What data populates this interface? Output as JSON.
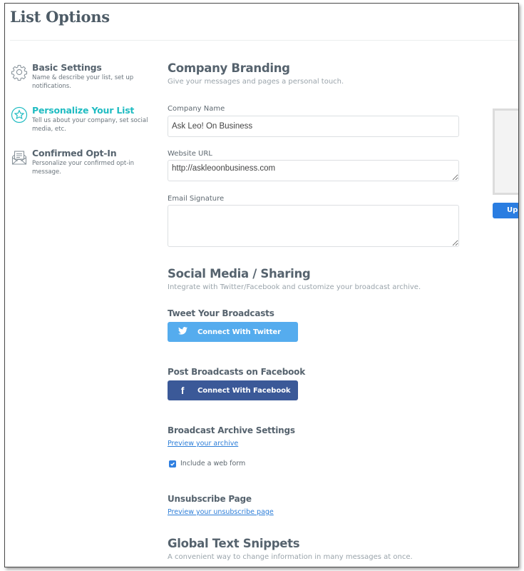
{
  "page": {
    "title": "List Options"
  },
  "sidebar": {
    "items": [
      {
        "label": "Basic Settings",
        "description": "Name & describe your list, set up notifications.",
        "icon": "gear-icon",
        "active": false
      },
      {
        "label": "Personalize Your List",
        "description": "Tell us about your company, set social media, etc.",
        "icon": "star-icon",
        "active": true
      },
      {
        "label": "Confirmed Opt-In",
        "description": "Personalize your confirmed opt-in message.",
        "icon": "envelope-icon",
        "active": false
      }
    ]
  },
  "branding": {
    "title": "Company Branding",
    "subtitle": "Give your messages and pages a personal touch.",
    "company_name_label": "Company Name",
    "company_name_value": "Ask Leo! On Business",
    "website_label": "Website URL",
    "website_value": "http://askleoonbusiness.com",
    "signature_label": "Email Signature",
    "signature_value": ""
  },
  "social": {
    "title": "Social Media / Sharing",
    "subtitle": "Integrate with Twitter/Facebook and customize your broadcast archive.",
    "twitter_heading": "Tweet Your Broadcasts",
    "twitter_button": "Connect With Twitter",
    "facebook_heading": "Post Broadcasts on Facebook",
    "facebook_button": "Connect With Facebook",
    "archive_heading": "Broadcast Archive Settings",
    "archive_link": "Preview your archive",
    "web_form_label": "Include a web form",
    "web_form_checked": true,
    "unsubscribe_heading": "Unsubscribe Page",
    "unsubscribe_link": "Preview your unsubscribe page"
  },
  "snippets": {
    "title": "Global Text Snippets",
    "subtitle": "A convenient way to change information in many messages at once."
  },
  "logo_panel": {
    "upload_button": "Upl"
  },
  "colors": {
    "accent": "#20bcc2",
    "twitter": "#55acee",
    "facebook": "#3b5998",
    "link": "#2d7ed8",
    "upload": "#2a7de1"
  }
}
